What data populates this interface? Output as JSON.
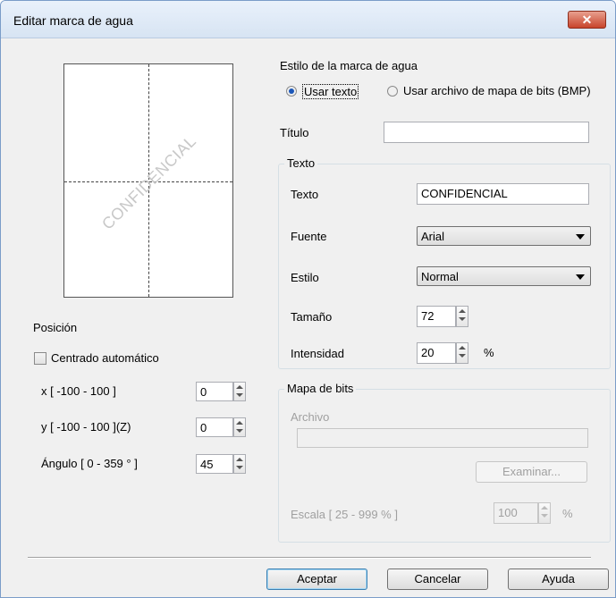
{
  "window": {
    "title": "Editar marca de agua",
    "close_icon": "✕"
  },
  "preview": {
    "watermark_text": "CONFIDENCIAL"
  },
  "position": {
    "section_label": "Posición",
    "auto_center_label": "Centrado automático",
    "auto_center_checked": false,
    "x_label": "x [ -100  -  100 ]",
    "x_value": "0",
    "y_label": "y [ -100  -  100 ](Z)",
    "y_value": "0",
    "angle_label": "Ángulo [ 0 - 359 ° ]",
    "angle_value": "45"
  },
  "style": {
    "section_label": "Estilo de la marca de agua",
    "use_text_label": "Usar texto",
    "use_bitmap_label": "Usar archivo de mapa de bits (BMP)",
    "selected": "text"
  },
  "title_field": {
    "label": "Título",
    "value": ""
  },
  "text_group": {
    "title": "Texto",
    "text_label": "Texto",
    "text_value": "CONFIDENCIAL",
    "font_label": "Fuente",
    "font_value": "Arial",
    "style_label": "Estilo",
    "style_value": "Normal",
    "size_label": "Tamaño",
    "size_value": "72",
    "intensity_label": "Intensidad",
    "intensity_value": "20",
    "intensity_unit": "%"
  },
  "bitmap_group": {
    "title": "Mapa de bits",
    "file_label": "Archivo",
    "file_value": "",
    "browse_label": "Examinar...",
    "scale_label": "Escala [ 25 - 999 % ]",
    "scale_value": "100",
    "scale_unit": "%"
  },
  "buttons": {
    "ok": "Aceptar",
    "cancel": "Cancelar",
    "help": "Ayuda"
  },
  "colors": {
    "titlebar": "#dbe6f4",
    "close": "#c8442b",
    "dialog_bg": "#f0f0f0"
  }
}
